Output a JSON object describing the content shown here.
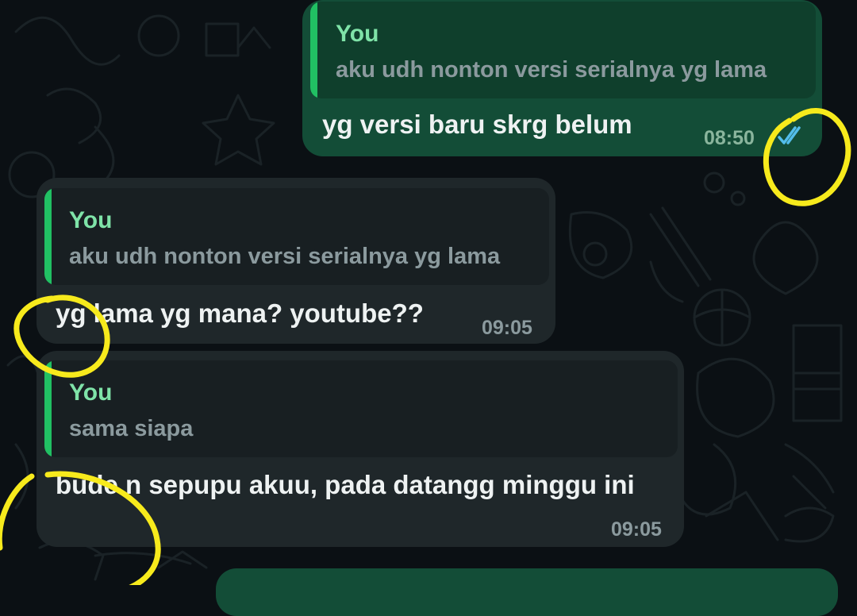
{
  "messages": [
    {
      "direction": "outgoing",
      "quote": {
        "author": "You",
        "text": "aku udh nonton versi serialnya yg lama"
      },
      "text": "yg versi baru skrg belum",
      "time": "08:50",
      "status_icon": "read-ticks-icon"
    },
    {
      "direction": "incoming",
      "quote": {
        "author": "You",
        "text": "aku udh nonton versi serialnya yg lama"
      },
      "text": "yg lama yg mana? youtube??",
      "time": "09:05"
    },
    {
      "direction": "incoming",
      "quote": {
        "author": "You",
        "text": "sama siapa"
      },
      "text": "bude n sepupu akuu, pada datangg minggu ini",
      "time": "09:05"
    }
  ],
  "colors": {
    "background": "#0b1014",
    "outgoing_bubble": "#134d37",
    "incoming_bubble": "#1f272a",
    "quote_bar": "#21c063",
    "quote_author": "#7fe3a8",
    "read_ticks": "#53bdeb",
    "highlight_annotation": "#f7ea1c"
  }
}
